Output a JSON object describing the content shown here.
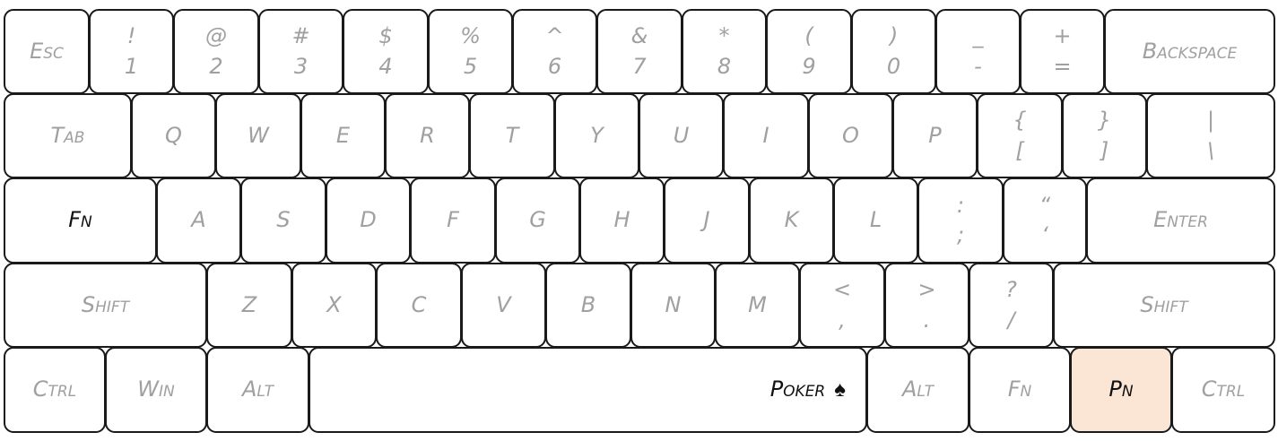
{
  "keyboard": {
    "highlight_color": "#fbe6d6",
    "rows": [
      [
        {
          "label": "Esc"
        },
        {
          "top": "!",
          "bot": "1"
        },
        {
          "top": "@",
          "bot": "2"
        },
        {
          "top": "#",
          "bot": "3"
        },
        {
          "top": "$",
          "bot": "4"
        },
        {
          "top": "%",
          "bot": "5"
        },
        {
          "top": "^",
          "bot": "6"
        },
        {
          "top": "&",
          "bot": "7"
        },
        {
          "top": "*",
          "bot": "8"
        },
        {
          "top": "(",
          "bot": "9"
        },
        {
          "top": ")",
          "bot": "0"
        },
        {
          "top": "_",
          "bot": "-"
        },
        {
          "top": "+",
          "bot": "="
        },
        {
          "label": "Backspace"
        }
      ],
      [
        {
          "label": "Tab"
        },
        {
          "label": "Q"
        },
        {
          "label": "W"
        },
        {
          "label": "E"
        },
        {
          "label": "R"
        },
        {
          "label": "T"
        },
        {
          "label": "Y"
        },
        {
          "label": "U"
        },
        {
          "label": "I"
        },
        {
          "label": "O"
        },
        {
          "label": "P"
        },
        {
          "top": "{",
          "bot": "["
        },
        {
          "top": "}",
          "bot": "]"
        },
        {
          "top": "|",
          "bot": "\\"
        }
      ],
      [
        {
          "label": "Fn",
          "dark": true
        },
        {
          "label": "A"
        },
        {
          "label": "S"
        },
        {
          "label": "D"
        },
        {
          "label": "F"
        },
        {
          "label": "G"
        },
        {
          "label": "H"
        },
        {
          "label": "J"
        },
        {
          "label": "K"
        },
        {
          "label": "L"
        },
        {
          "top": ":",
          "bot": ";"
        },
        {
          "top": "“",
          "bot": "‘"
        },
        {
          "label": "Enter"
        }
      ],
      [
        {
          "label": "Shift"
        },
        {
          "label": "Z"
        },
        {
          "label": "X"
        },
        {
          "label": "C"
        },
        {
          "label": "V"
        },
        {
          "label": "B"
        },
        {
          "label": "N"
        },
        {
          "label": "M"
        },
        {
          "top": "<",
          "bot": ","
        },
        {
          "top": ">",
          "bot": "."
        },
        {
          "top": "?",
          "bot": "/"
        },
        {
          "label": "Shift"
        }
      ],
      [
        {
          "label": "Ctrl"
        },
        {
          "label": "Win"
        },
        {
          "label": "Alt"
        },
        {
          "label": "Poker",
          "icon": "♠",
          "dark": true,
          "space": true
        },
        {
          "label": "Alt"
        },
        {
          "label": "Fn"
        },
        {
          "label": "Pn",
          "dark": true,
          "highlight": true
        },
        {
          "label": "Ctrl"
        }
      ]
    ]
  }
}
